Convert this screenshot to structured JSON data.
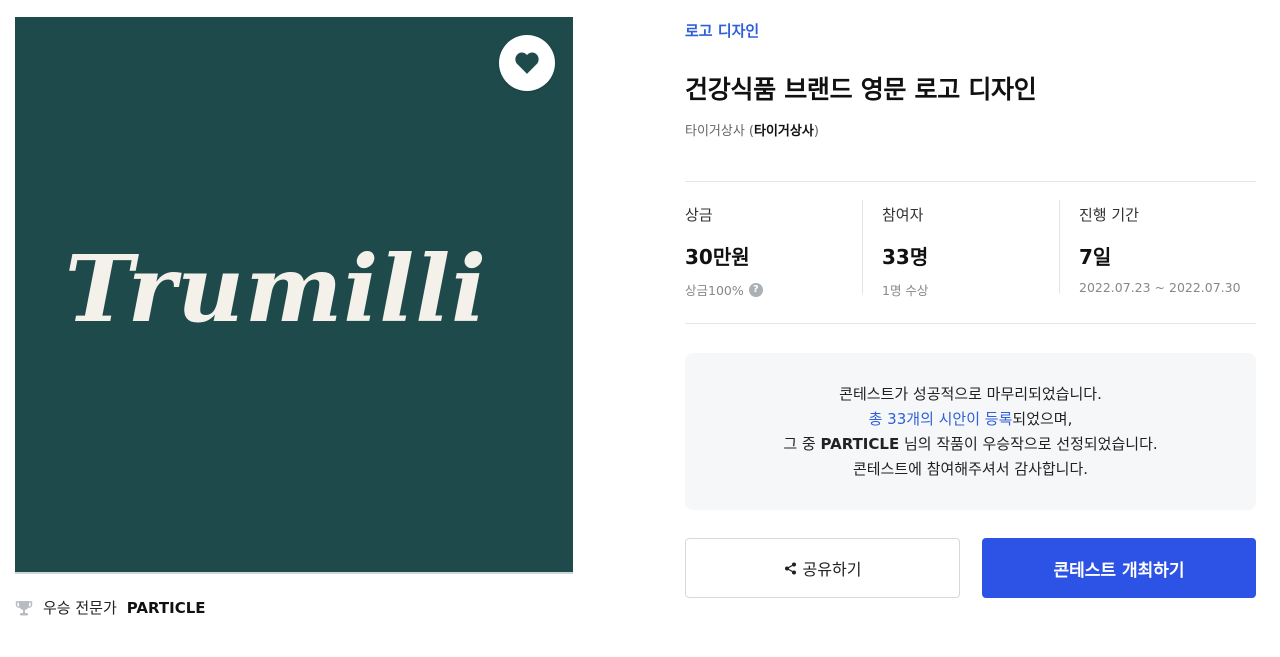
{
  "artwork": {
    "logo_text": "Trumilli",
    "bg_color": "#1f4a4c"
  },
  "winner": {
    "label": "우승 전문가",
    "name": "PARTICLE"
  },
  "contest": {
    "category": "로고 디자인",
    "title": "건강식품 브랜드 영문 로고 디자인",
    "host_prefix": "타이거상사 (",
    "host_name": "타이거상사",
    "host_suffix": ")"
  },
  "stats": [
    {
      "label": "상금",
      "value": "30만원",
      "sub": "상금100%"
    },
    {
      "label": "참여자",
      "value": "33명",
      "sub": "1명 수상"
    },
    {
      "label": "진행 기간",
      "value": "7일",
      "sub": "2022.07.23 ~ 2022.07.30"
    }
  ],
  "notice": {
    "line1": "콘테스트가 성공적으로 마무리되었습니다.",
    "line2_link": "총 33개의 시안이 등록",
    "line2_rest": "되었으며,",
    "line3_pre": "그 중 ",
    "line3_name": "PARTICLE",
    "line3_post": " 님의 작품이 우승작으로 선정되었습니다.",
    "line4": "콘테스트에 참여해주셔서 감사합니다."
  },
  "buttons": {
    "share_label": "공유하기",
    "host_label": "콘테스트 개최하기"
  },
  "colors": {
    "accent": "#2f5fd9",
    "primary_button": "#2d52e6"
  },
  "icons": {
    "favorite": "heart-icon",
    "trophy": "trophy-icon",
    "share": "share-icon",
    "help": "help-icon"
  }
}
